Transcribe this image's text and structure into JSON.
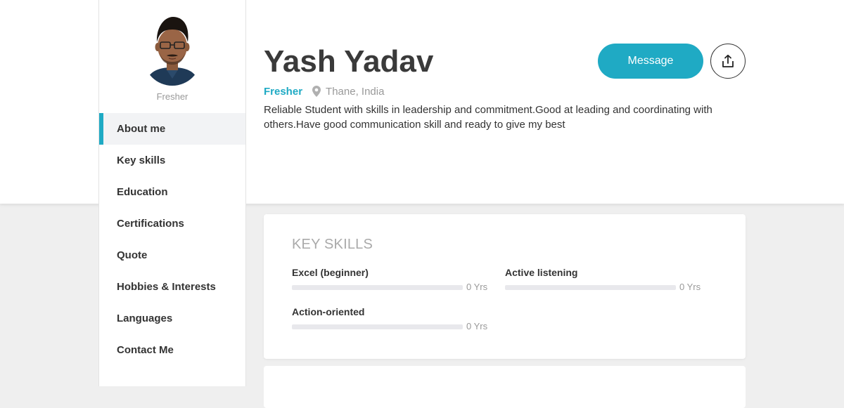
{
  "profile": {
    "name": "Yash Yadav",
    "status": "Fresher",
    "role": "Fresher",
    "location": "Thane, India",
    "bio": "Reliable Student with skills in leadership and commitment.Good at leading and coordinating with others.Have good communication skill and ready to give my best"
  },
  "actions": {
    "message_label": "Message",
    "share_icon": "share-icon"
  },
  "nav": {
    "items": [
      {
        "label": "About me",
        "active": true
      },
      {
        "label": "Key skills"
      },
      {
        "label": "Education"
      },
      {
        "label": "Certifications"
      },
      {
        "label": "Quote"
      },
      {
        "label": "Hobbies & Interests"
      },
      {
        "label": "Languages"
      },
      {
        "label": "Contact Me"
      }
    ]
  },
  "key_skills": {
    "title": "KEY SKILLS",
    "items": [
      {
        "name": "Excel (beginner)",
        "years": "0 Yrs",
        "level": 0
      },
      {
        "name": "Active listening",
        "years": "0 Yrs",
        "level": 0
      },
      {
        "name": "Action-oriented",
        "years": "0 Yrs",
        "level": 0
      }
    ]
  },
  "colors": {
    "accent": "#1faac4",
    "page_bg": "#efefef",
    "muted": "#999999"
  }
}
